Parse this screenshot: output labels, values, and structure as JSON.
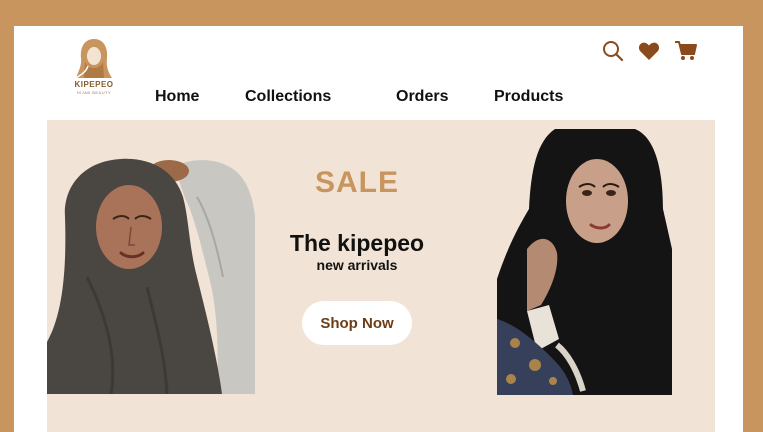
{
  "brand": {
    "name": "KIPEPEO",
    "tagline": "HIJAB BEAUTY",
    "logo_icon": "hijab-woman-logo-icon"
  },
  "header": {
    "icons": [
      "search-icon",
      "heart-icon",
      "cart-icon"
    ],
    "accent_color": "#8a4a1c"
  },
  "nav": {
    "items": [
      {
        "label": "Home"
      },
      {
        "label": "Collections"
      },
      {
        "label": "Orders"
      },
      {
        "label": "Products"
      }
    ]
  },
  "hero": {
    "sale_label": "SALE",
    "headline": "The kipepeo",
    "subline": "new arrivals",
    "cta_label": "Shop Now",
    "background_color": "#f1e3d5",
    "sale_color": "#c9955e",
    "frame_color": "#c9955e"
  }
}
